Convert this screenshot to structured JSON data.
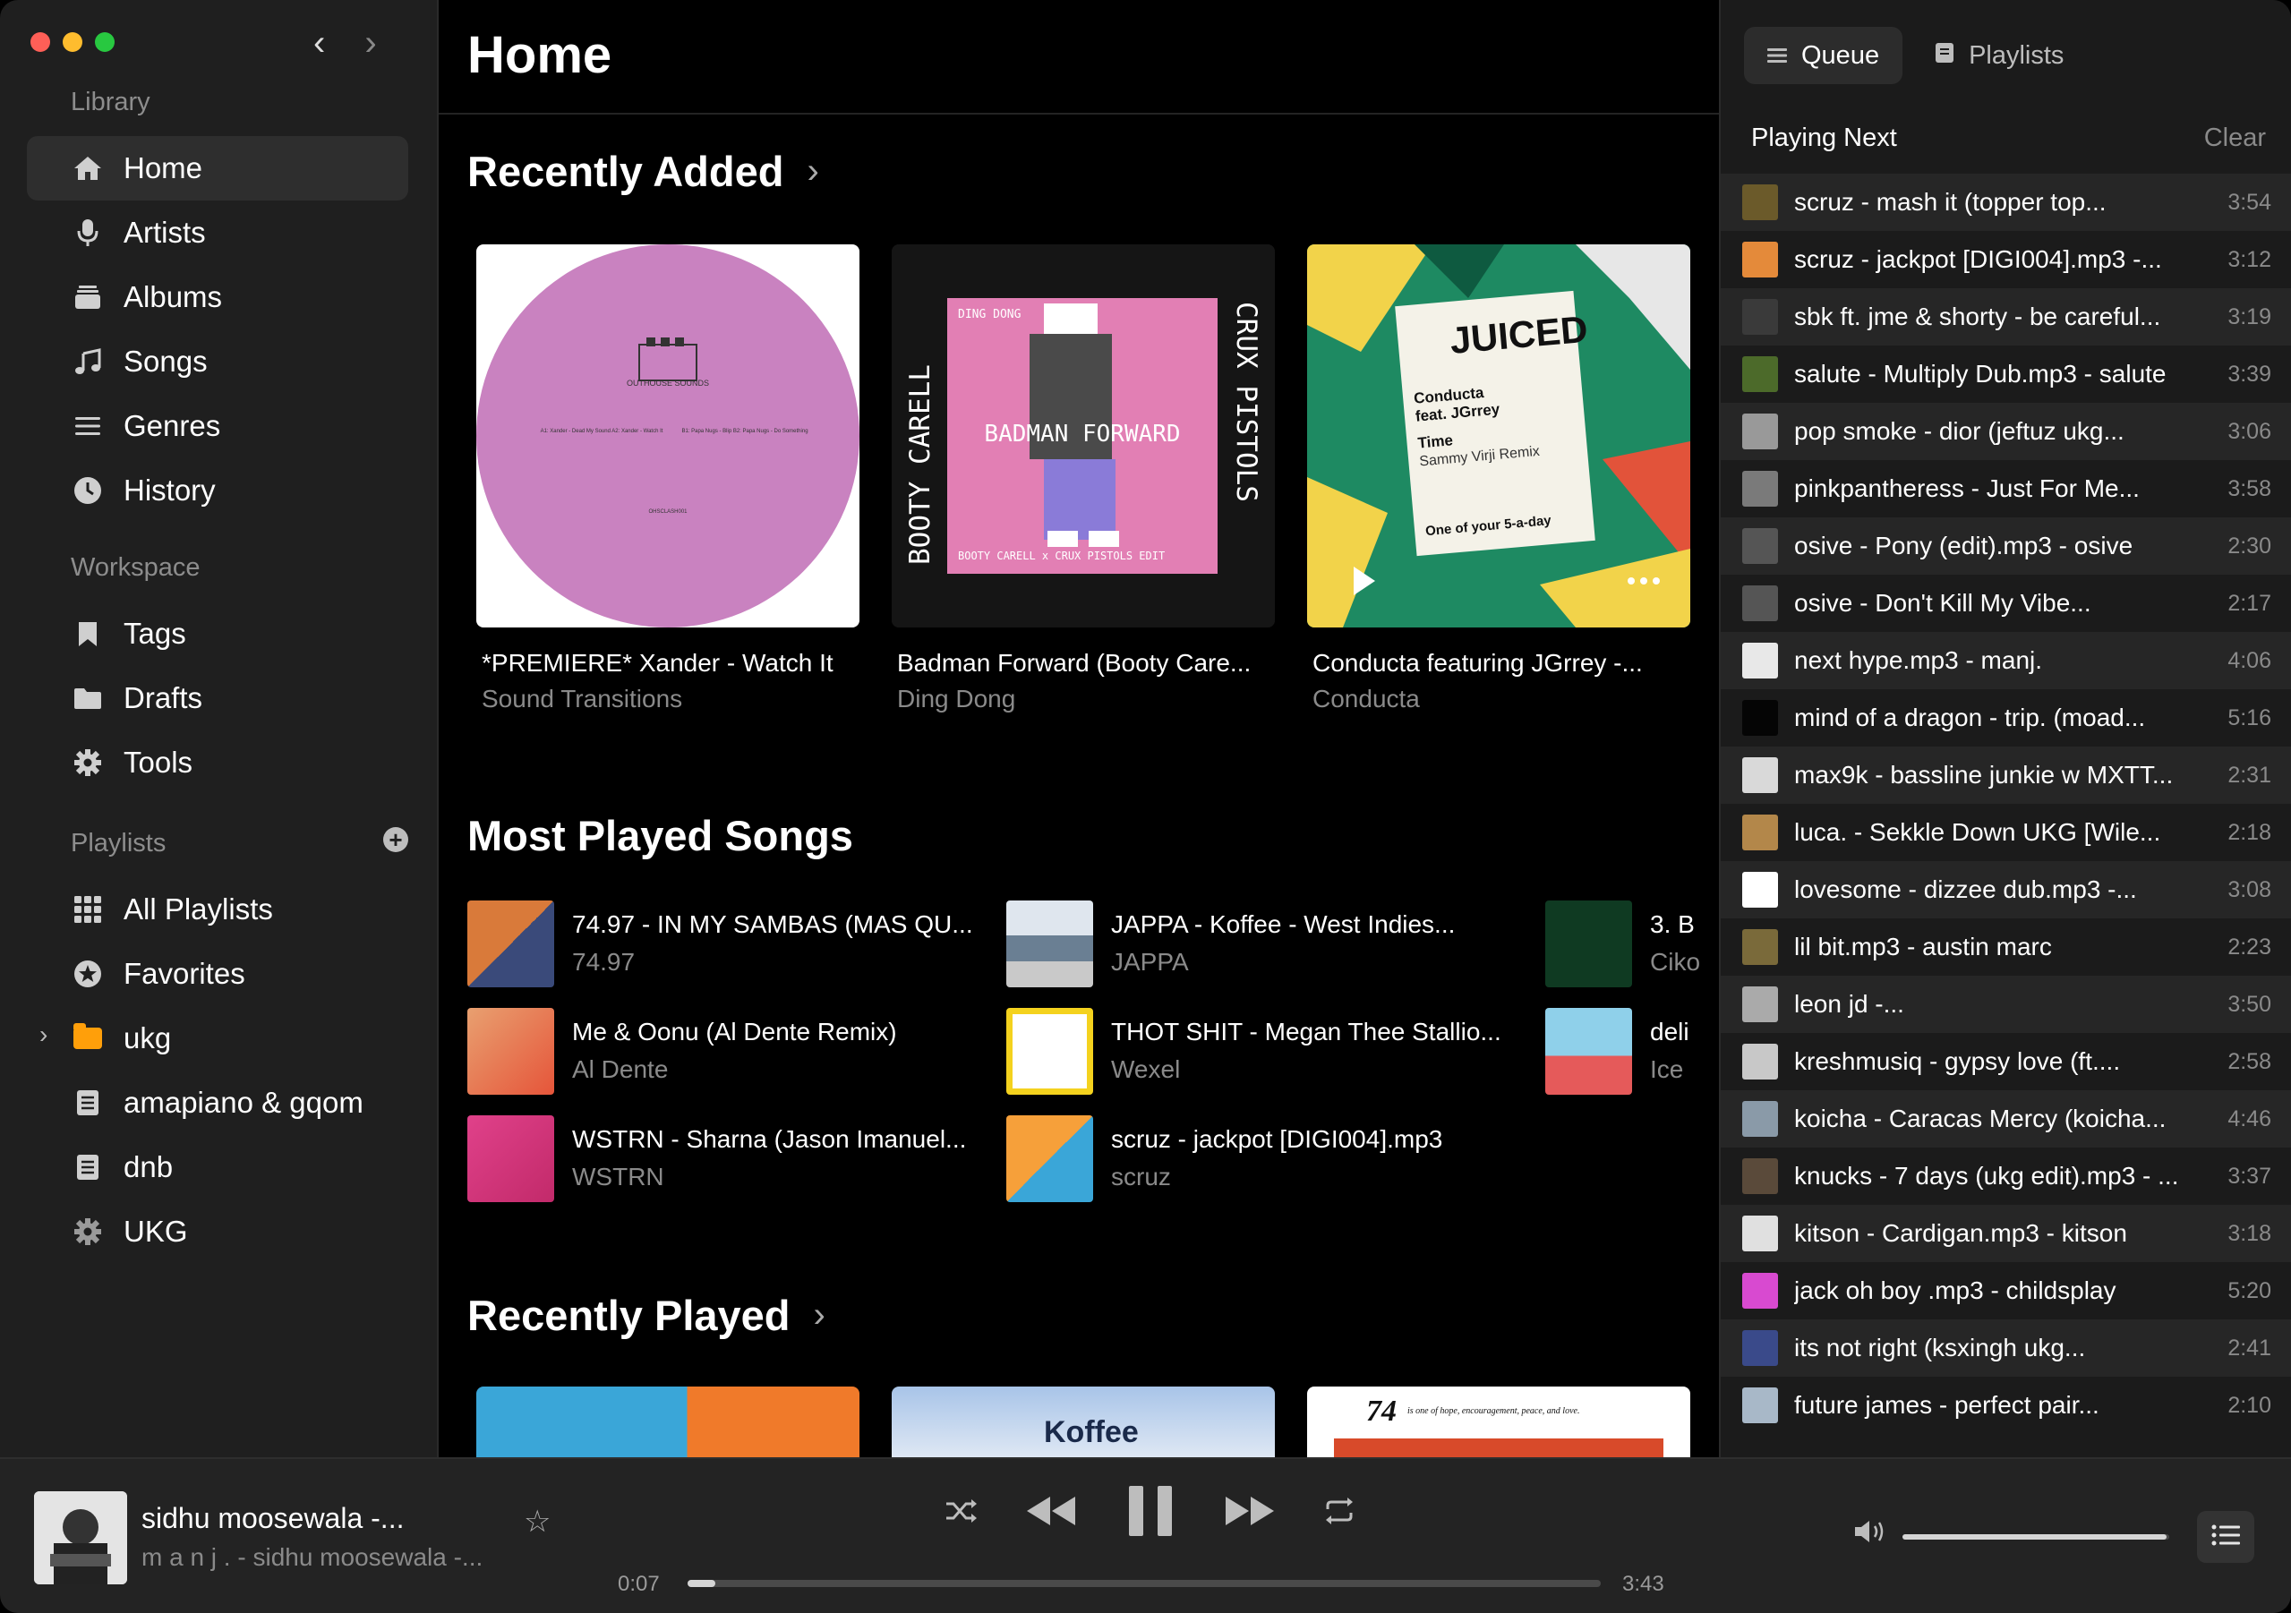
{
  "sidebar": {
    "library_title": "Library",
    "library_items": [
      {
        "label": "Home",
        "icon": "house-icon"
      },
      {
        "label": "Artists",
        "icon": "microphone-icon"
      },
      {
        "label": "Albums",
        "icon": "album-stack-icon"
      },
      {
        "label": "Songs",
        "icon": "music-note-icon"
      },
      {
        "label": "Genres",
        "icon": "list-icon"
      },
      {
        "label": "History",
        "icon": "clock-icon"
      }
    ],
    "workspace_title": "Workspace",
    "workspace_items": [
      {
        "label": "Tags",
        "icon": "bookmark-icon"
      },
      {
        "label": "Drafts",
        "icon": "folder-icon"
      },
      {
        "label": "Tools",
        "icon": "gear-icon"
      }
    ],
    "playlists_title": "Playlists",
    "playlist_items": [
      {
        "label": "All Playlists",
        "icon": "grid-icon"
      },
      {
        "label": "Favorites",
        "icon": "star-circle-icon"
      },
      {
        "label": "ukg",
        "icon": "folder-icon"
      },
      {
        "label": "amapiano & gqom",
        "icon": "playlist-icon"
      },
      {
        "label": "dnb",
        "icon": "playlist-icon"
      },
      {
        "label": "UKG",
        "icon": "gear-icon"
      }
    ]
  },
  "main": {
    "title": "Home",
    "recently_added": {
      "title": "Recently Added",
      "cards": [
        {
          "title": "*PREMIERE* Xander - Watch It",
          "subtitle": "Sound Transitions"
        },
        {
          "title": "Badman Forward (Booty Care...",
          "subtitle": "Ding Dong"
        },
        {
          "title": "Conducta featuring JGrrey -...",
          "subtitle": "Conducta"
        }
      ]
    },
    "most_played": {
      "title": "Most Played Songs",
      "songs": [
        {
          "title": "74.97 - IN MY SAMBAS (MAS QU...",
          "artist": "74.97"
        },
        {
          "title": "JAPPA - Koffee - West Indies...",
          "artist": "JAPPA"
        },
        {
          "title": "3. B",
          "artist": "Ciko"
        },
        {
          "title": "Me & Oonu (Al Dente Remix)",
          "artist": "Al Dente"
        },
        {
          "title": "THOT SHIT - Megan Thee Stallio...",
          "artist": "Wexel"
        },
        {
          "title": "deli",
          "artist": "Ice"
        },
        {
          "title": "WSTRN - Sharna (Jason Imanuel...",
          "artist": "WSTRN"
        },
        {
          "title": "scruz - jackpot [DIGI004].mp3",
          "artist": "scruz"
        }
      ]
    },
    "recently_played": {
      "title": "Recently Played"
    },
    "art_text": {
      "a1_label": "OUTHOUSE SOUNDS",
      "a1_side_a": "A1: Xander - Dead My Sound  A2: Xander - Watch It",
      "a1_side_b": "B1: Papa Nugs - Blip  B2: Papa Nugs - Do Something",
      "a1_cat": "OHSCLASH001",
      "a2_top": "DING DONG",
      "a2_left": "BOOTY CARELL",
      "a2_right": "CRUX PISTOLS",
      "a2_center": "BADMAN FORWARD",
      "a2_bottom": "BOOTY CARELL x CRUX PISTOLS EDIT",
      "a3_brand": "JUICED",
      "a3_line1": "Conducta",
      "a3_line2": "feat. JGrrey",
      "a3_line3": "Time",
      "a3_line4": "Sammy Virji Remix",
      "a3_foot": "One of your 5-a-day",
      "rp2": "Koffee",
      "rp3_num": "74",
      "rp3_text": "is one of hope, encouragement, peace, and love."
    }
  },
  "right": {
    "tabs": [
      {
        "label": "Queue",
        "icon": "queue-list-icon"
      },
      {
        "label": "Playlists",
        "icon": "playlist-book-icon"
      }
    ],
    "playing_next": "Playing Next",
    "clear_label": "Clear",
    "queue": [
      {
        "title": "scruz - mash it (topper top...",
        "duration": "3:54",
        "color": "#6b5a2a"
      },
      {
        "title": "scruz - jackpot [DIGI004].mp3 -...",
        "duration": "3:12",
        "color": "#e48a3a"
      },
      {
        "title": "sbk ft. jme & shorty - be careful...",
        "duration": "3:19",
        "color": "#3a3a3a"
      },
      {
        "title": "salute - Multiply Dub.mp3 - salute",
        "duration": "3:39",
        "color": "#4c6a2a"
      },
      {
        "title": "pop smoke - dior (jeftuz ukg...",
        "duration": "3:06",
        "color": "#999999"
      },
      {
        "title": "pinkpantheress - Just For Me...",
        "duration": "3:58",
        "color": "#7a7a7a"
      },
      {
        "title": "osive - Pony (edit).mp3 - osive",
        "duration": "2:30",
        "color": "#555555"
      },
      {
        "title": "osive - Don't Kill My Vibe...",
        "duration": "2:17",
        "color": "#555555"
      },
      {
        "title": "next hype.mp3 - manj.",
        "duration": "4:06",
        "color": "#e8e8e8"
      },
      {
        "title": "mind of a dragon - trip. (moad...",
        "duration": "5:16",
        "color": "#050505"
      },
      {
        "title": "max9k - bassline junkie w MXTT...",
        "duration": "2:31",
        "color": "#d9d9d9"
      },
      {
        "title": "luca. - Sekkle Down UKG [Wile...",
        "duration": "2:18",
        "color": "#b3874a"
      },
      {
        "title": "lovesome - dizzee dub.mp3 -...",
        "duration": "3:08",
        "color": "#ffffff"
      },
      {
        "title": "lil bit.mp3 - austin marc",
        "duration": "2:23",
        "color": "#7a6a3a"
      },
      {
        "title": "leon jd -...",
        "duration": "3:50",
        "color": "#aaaaaa"
      },
      {
        "title": "kreshmusiq - gypsy love (ft....",
        "duration": "2:58",
        "color": "#c8c8c8"
      },
      {
        "title": "koicha - Caracas Mercy (koicha...",
        "duration": "4:46",
        "color": "#8a9aa8"
      },
      {
        "title": "knucks - 7 days (ukg edit).mp3 - ...",
        "duration": "3:37",
        "color": "#5a4a3a"
      },
      {
        "title": "kitson - Cardigan.mp3 - kitson",
        "duration": "3:18",
        "color": "#e0e0e0"
      },
      {
        "title": "jack oh boy .mp3 - childsplay",
        "duration": "5:20",
        "color": "#d84ad0"
      },
      {
        "title": "its not right (ksxingh ukg...",
        "duration": "2:41",
        "color": "#3a4a8a"
      },
      {
        "title": "future james - perfect pair...",
        "duration": "2:10",
        "color": "#a8b8c8"
      }
    ]
  },
  "player": {
    "title": "sidhu moosewala -...",
    "subtitle": "m a n j . - sidhu moosewala -...",
    "current_time": "0:07",
    "total_time": "3:43",
    "progress": 0.03,
    "volume": 0.99
  }
}
